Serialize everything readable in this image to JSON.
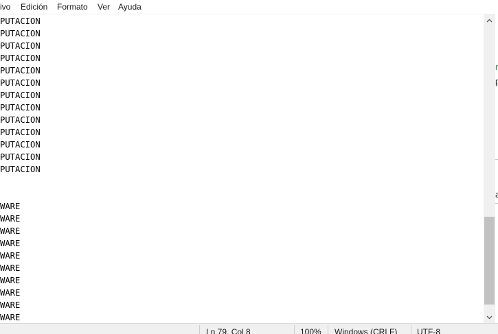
{
  "menu": {
    "items": [
      "ivo",
      "Edición",
      "Formato",
      "Ver",
      "Ayuda"
    ]
  },
  "editor": {
    "lines": [
      "PUTACION",
      "PUTACION",
      "PUTACION",
      "PUTACION",
      "PUTACION",
      "PUTACION",
      "PUTACION",
      "PUTACION",
      "PUTACION",
      "PUTACION",
      "PUTACION",
      "PUTACION",
      "PUTACION",
      "",
      "",
      "WARE",
      "WARE",
      "WARE",
      "WARE",
      "WARE",
      "WARE",
      "WARE",
      "WARE",
      "WARE",
      "WARE"
    ]
  },
  "background_window": {
    "glyphs": [
      "n",
      "p",
      "a"
    ],
    "accent_color": "#2e8b57"
  },
  "statusbar": {
    "position": "Ln 79, Col 8",
    "zoom": "100%",
    "line_ending": "Windows (CRLF)",
    "encoding": "UTF-8"
  }
}
